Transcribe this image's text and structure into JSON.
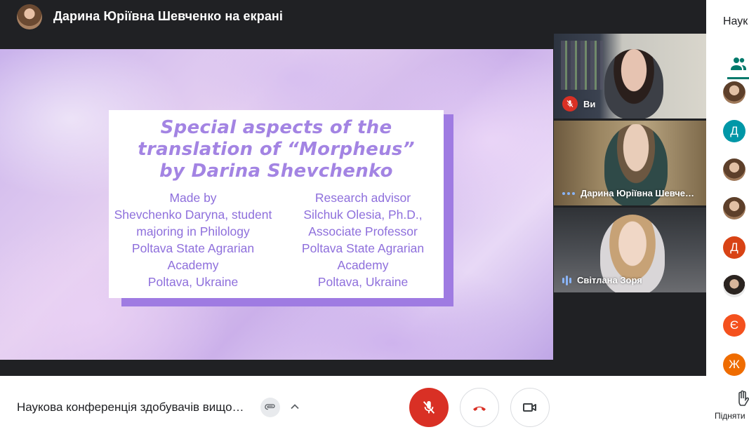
{
  "header": {
    "presenter_title": "Дарина Юріївна Шевченко на екрані"
  },
  "slide": {
    "title_lines": [
      "Special aspects of the",
      "translation of “Morpheus”",
      "by Darina Shevchenko"
    ],
    "left_column": [
      "Made by",
      "Shevchenko Daryna, student",
      "majoring in Philology",
      "Poltava State Agrarian",
      "Academy",
      "Poltava, Ukraine"
    ],
    "right_column": [
      "Research advisor",
      "Silchuk Olesia, Ph.D.,",
      "Associate Professor",
      "Poltava State Agrarian",
      "Academy",
      "Poltava, Ukraine"
    ]
  },
  "tiles": [
    {
      "label": "Ви",
      "status_icon": "mic-off-icon"
    },
    {
      "label": "Дарина Юріївна Шевче…",
      "status_icon": "more-dots-icon"
    },
    {
      "label": "Світлана Зоря",
      "status_icon": "speaking-bars-icon"
    }
  ],
  "side_panel": {
    "title": "Наук",
    "active_tab_icon": "people-icon",
    "participants": [
      {
        "initial": "",
        "type": "photo",
        "color": ""
      },
      {
        "initial": "Д",
        "type": "letter",
        "color": "#0097a7"
      },
      {
        "initial": "",
        "type": "photo",
        "color": ""
      },
      {
        "initial": "",
        "type": "photo",
        "color": ""
      },
      {
        "initial": "Д",
        "type": "letter",
        "color": "#d84315"
      },
      {
        "initial": "",
        "type": "photo-man",
        "color": ""
      },
      {
        "initial": "Є",
        "type": "letter",
        "color": "#f4511e"
      },
      {
        "initial": "Ж",
        "type": "letter",
        "color": "#ef6c00"
      }
    ]
  },
  "bottom_bar": {
    "meeting_title": "Наукова конференція здобувачів вищо…",
    "raise_hand_label": "Підняти"
  },
  "colors": {
    "mic_off": "#d93025",
    "end_call": "#d93025",
    "accent_teal": "#00796b",
    "slide_text": "#8e6fdc"
  }
}
